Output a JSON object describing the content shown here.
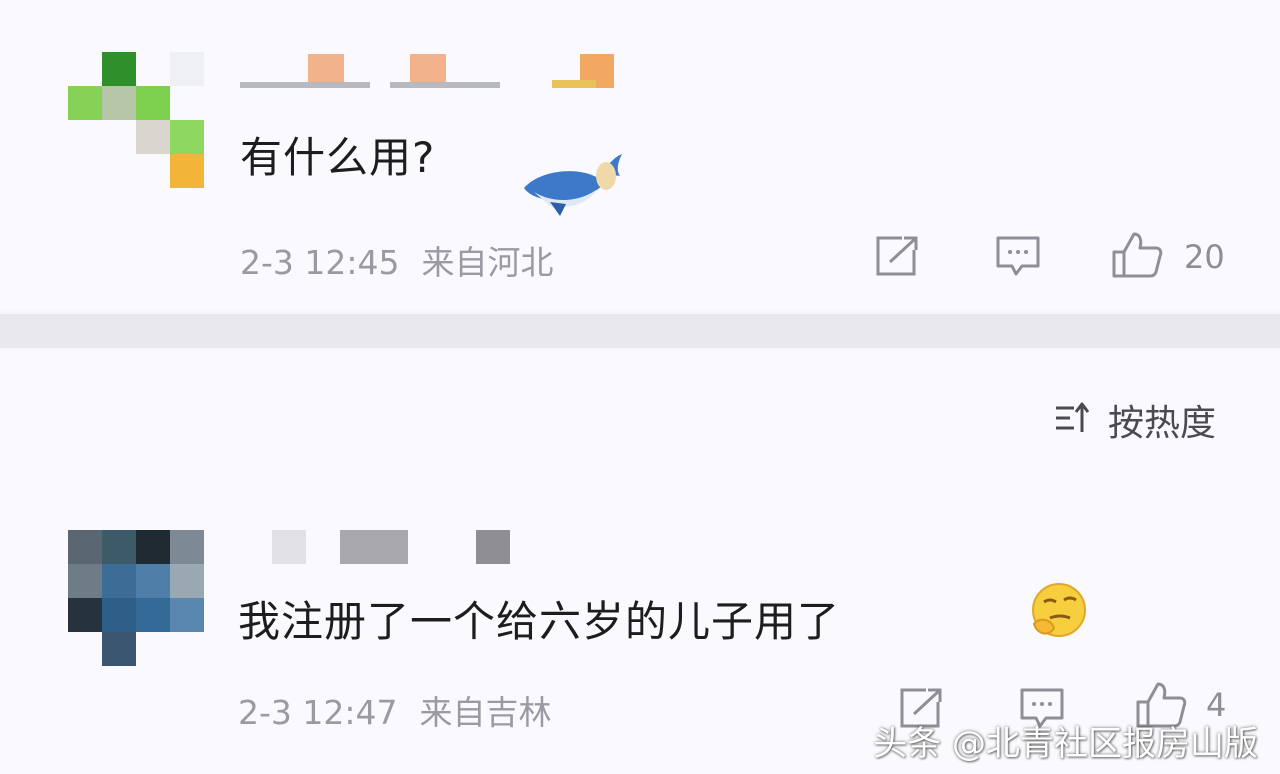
{
  "comments": [
    {
      "text": "有什么用?",
      "time": "2-3 12:45",
      "location": "来自河北",
      "likes": "20",
      "emoji_icon": "whale-sticker"
    },
    {
      "text": "我注册了一个给六岁的儿子用了",
      "time": "2-3 12:47",
      "location": "来自吉林",
      "likes": "4",
      "emoji_icon": "thinking-face-emoji"
    }
  ],
  "sort": {
    "icon": "sort-icon",
    "label": "按热度"
  },
  "watermark": "头条 @北青社区报房山版",
  "colors": {
    "text": "#1d1d1f",
    "meta": "#9a9aa4",
    "separator": "#e9e9ed",
    "background": "#fafafe"
  }
}
